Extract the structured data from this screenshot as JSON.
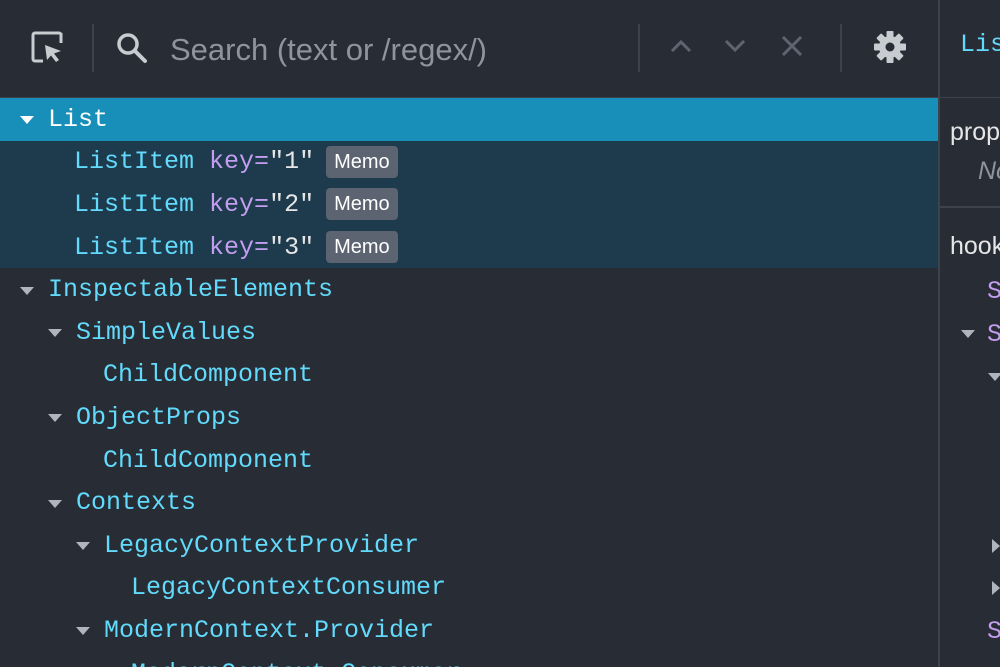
{
  "toolbar": {
    "inspect_icon": "select-element-icon",
    "search_icon": "search-icon",
    "search_placeholder": "Search (text or /regex/)",
    "search_value": "",
    "prev_icon": "chevron-up-icon",
    "next_icon": "chevron-down-icon",
    "clear_icon": "close-icon",
    "settings_icon": "gear-icon"
  },
  "tree": {
    "rows": [
      {
        "name": "List",
        "expanded": true,
        "selected": true
      },
      {
        "name": "ListItem",
        "key_label": "key",
        "key_value": "\"1\"",
        "badge": "Memo"
      },
      {
        "name": "ListItem",
        "key_label": "key",
        "key_value": "\"2\"",
        "badge": "Memo"
      },
      {
        "name": "ListItem",
        "key_label": "key",
        "key_value": "\"3\"",
        "badge": "Memo"
      },
      {
        "name": "InspectableElements",
        "expanded": true
      },
      {
        "name": "SimpleValues",
        "expanded": true
      },
      {
        "name": "ChildComponent"
      },
      {
        "name": "ObjectProps",
        "expanded": true
      },
      {
        "name": "ChildComponent"
      },
      {
        "name": "Contexts",
        "expanded": true
      },
      {
        "name": "LegacyContextProvider",
        "expanded": true
      },
      {
        "name": "LegacyContextConsumer"
      },
      {
        "name": "ModernContext.Provider",
        "expanded": true
      },
      {
        "name": "ModernContext.Consumer"
      }
    ]
  },
  "props_panel": {
    "title": "Lis",
    "props_label": "prop",
    "props_empty": "No",
    "hooks_label": "hook",
    "hook_fragments": [
      "S",
      "S",
      "S"
    ]
  },
  "colors": {
    "background": "#282c34",
    "selected_row": "#178fb9",
    "selected_children_row": "#1e3a4d",
    "component_name": "#61dafb",
    "key_attribute": "#c39df0",
    "badge_bg": "#5b6470"
  }
}
